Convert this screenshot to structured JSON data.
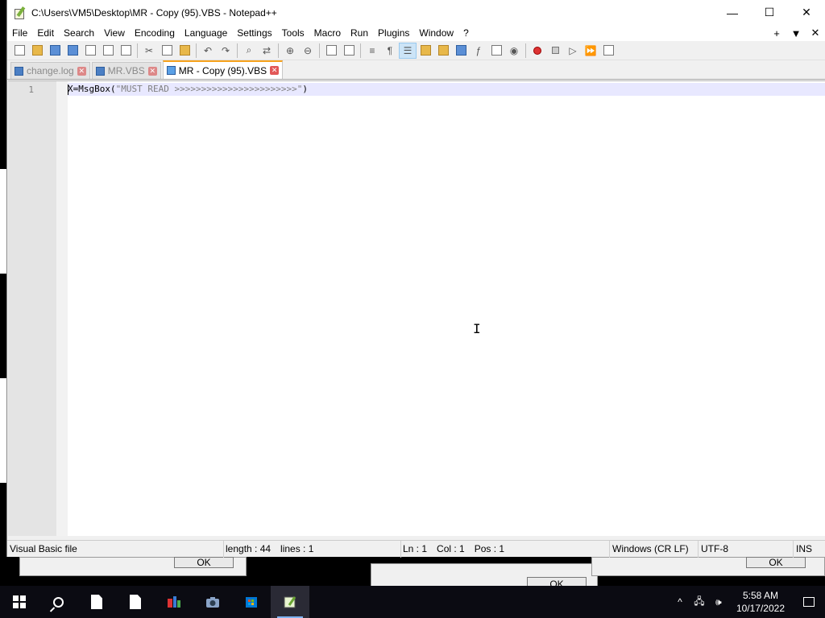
{
  "window": {
    "title": "C:\\Users\\VM5\\Desktop\\MR - Copy (95).VBS - Notepad++",
    "controls": {
      "minimize": "—",
      "maximize": "☐",
      "close": "✕"
    }
  },
  "menu": {
    "items": [
      "File",
      "Edit",
      "Search",
      "View",
      "Encoding",
      "Language",
      "Settings",
      "Tools",
      "Macro",
      "Run",
      "Plugins",
      "Window",
      "?"
    ],
    "right": {
      "add": "+",
      "dropdown": "▼",
      "close": "✕"
    }
  },
  "tabs": [
    {
      "label": "change.log",
      "active": false
    },
    {
      "label": "MR.VBS",
      "active": false
    },
    {
      "label": "MR - Copy (95).VBS",
      "active": true
    }
  ],
  "editor": {
    "line_number": "1",
    "code_prefix": "X=MsgBox(",
    "code_string": "\"MUST READ >>>>>>>>>>>>>>>>>>>>>>>\"",
    "code_suffix": ")"
  },
  "status": {
    "file_type": "Visual Basic file",
    "length": "length : 44",
    "lines": "lines : 1",
    "ln": "Ln : 1",
    "col": "Col : 1",
    "pos": "Pos : 1",
    "eol": "Windows (CR LF)",
    "encoding": "UTF-8",
    "mode": "INS"
  },
  "background": {
    "ok_labels": [
      "OK",
      "OK",
      "OK"
    ]
  },
  "taskbar": {
    "time": "5:58 AM",
    "date": "10/17/2022"
  }
}
